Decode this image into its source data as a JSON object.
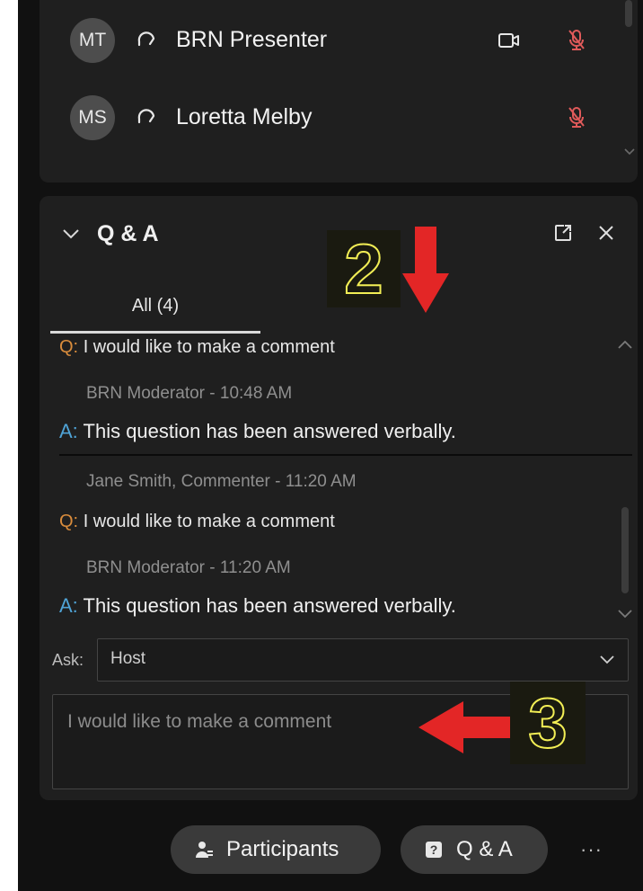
{
  "participants": [
    {
      "initials": "MT",
      "name": "BRN Presenter",
      "has_camera": true,
      "muted": true
    },
    {
      "initials": "MS",
      "name": "Loretta Melby",
      "has_camera": false,
      "muted": true
    }
  ],
  "qa_panel": {
    "title": "Q & A",
    "tab_all": "All (4)",
    "items": [
      {
        "kind": "question",
        "mark": "Q:",
        "text": "I would like to make a comment"
      },
      {
        "kind": "meta",
        "text": "BRN Moderator - 10:48 AM"
      },
      {
        "kind": "answer",
        "mark": "A:",
        "text": "This question has been answered verbally."
      },
      {
        "kind": "meta",
        "text": "Jane Smith, Commenter  - 11:20 AM"
      },
      {
        "kind": "question",
        "mark": "Q:",
        "text": "I would like to make a comment"
      },
      {
        "kind": "meta",
        "text": "BRN Moderator - 11:20 AM"
      },
      {
        "kind": "answer",
        "mark": "A:",
        "text": "This question has been answered verbally."
      }
    ],
    "ask_label": "Ask:",
    "ask_value": "Host",
    "comment_value": "",
    "comment_placeholder": "I would like to make a comment"
  },
  "bottom_bar": {
    "participants_label": "Participants",
    "qa_label": "Q & A",
    "more_label": "···"
  },
  "annotations": {
    "step_2": "2",
    "step_3": "3"
  },
  "colors": {
    "question_mark": "#d98c3c",
    "answer_mark": "#4fa3d6",
    "muted_mic": "#e05a5a",
    "annotation_arrow": "#e32626",
    "annotation_number": "#f2ee55"
  },
  "icons": {
    "participant_status": "headset-icon",
    "camera": "camera-icon",
    "mic": "mic-muted-icon",
    "collapse": "chevron-down-icon",
    "popout": "popout-icon",
    "close": "close-icon",
    "participants_pill": "person-icon",
    "qa_pill": "question-icon"
  }
}
